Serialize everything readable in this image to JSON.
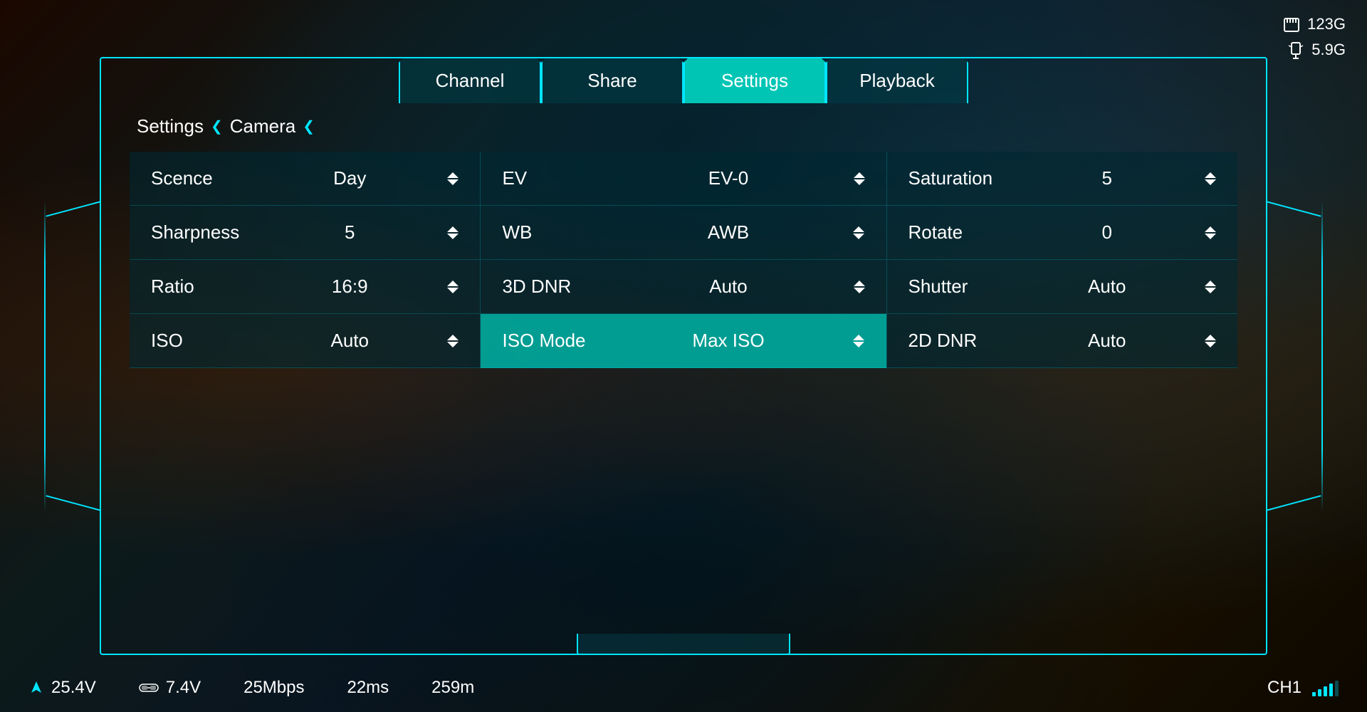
{
  "background": {
    "color": "#0a1a1a"
  },
  "top_status": {
    "storage1_icon": "sd-card-icon",
    "storage1_value": "123G",
    "storage2_icon": "sd-card-icon",
    "storage2_value": "5.9G"
  },
  "tabs": [
    {
      "id": "channel",
      "label": "Channel",
      "active": false
    },
    {
      "id": "share",
      "label": "Share",
      "active": false
    },
    {
      "id": "settings",
      "label": "Settings",
      "active": true
    },
    {
      "id": "playback",
      "label": "Playback",
      "active": false
    }
  ],
  "breadcrumb": {
    "items": [
      "Settings",
      "Camera"
    ]
  },
  "settings_rows": [
    {
      "cells": [
        {
          "label": "Scence",
          "value": "Day"
        },
        {
          "label": "EV",
          "value": "EV-0"
        },
        {
          "label": "Saturation",
          "value": "5"
        }
      ]
    },
    {
      "cells": [
        {
          "label": "Sharpness",
          "value": "5"
        },
        {
          "label": "WB",
          "value": "AWB"
        },
        {
          "label": "Rotate",
          "value": "0"
        }
      ]
    },
    {
      "cells": [
        {
          "label": "Ratio",
          "value": "16:9"
        },
        {
          "label": "3D DNR",
          "value": "Auto"
        },
        {
          "label": "Shutter",
          "value": "Auto"
        }
      ]
    },
    {
      "cells": [
        {
          "label": "ISO",
          "value": "Auto"
        },
        {
          "label": "ISO Mode",
          "value": "Max ISO",
          "highlighted": true
        },
        {
          "label": "2D DNR",
          "value": "Auto"
        }
      ]
    }
  ],
  "bottom_bar": {
    "voltage1_icon": "navigation-icon",
    "voltage1_value": "25.4V",
    "voltage2_icon": "goggles-icon",
    "voltage2_value": "7.4V",
    "bitrate": "25Mbps",
    "latency": "22ms",
    "distance": "259m",
    "channel": "CH1",
    "signal_bars": 4
  },
  "accent_color": "#00e5ff",
  "highlight_color": "#00c5b5"
}
